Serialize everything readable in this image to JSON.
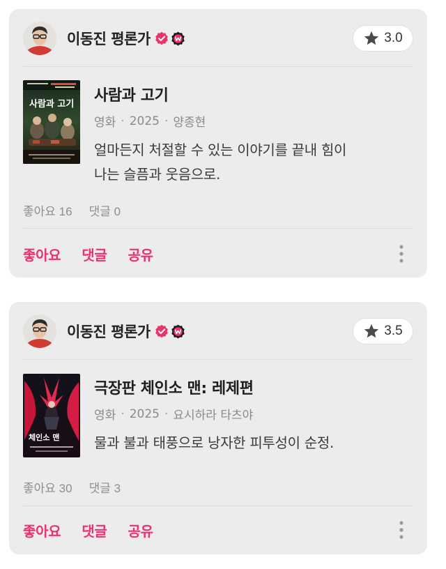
{
  "reviews": [
    {
      "author": "이동진 평론가",
      "rating": "3.0",
      "title": "사람과 고기",
      "category": "영화",
      "year": "2025",
      "director": "양종현",
      "text_lines": [
        "얼마든지 처절할 수 있는 이야기를 끝내 힘이",
        "나는 슬픔과 웃음으로."
      ],
      "likes": "좋아요 16",
      "comments": "댓글 0",
      "poster_title": "사람과 고기"
    },
    {
      "author": "이동진 평론가",
      "rating": "3.5",
      "title": "극장판 체인소 맨: 레제편",
      "category": "영화",
      "year": "2025",
      "director": "요시하라 타츠야",
      "text_lines": [
        "물과 불과 태풍으로 낭자한 피투성이 순정."
      ],
      "likes": "좋아요 30",
      "comments": "댓글 3",
      "poster_title": "체인소 맨"
    }
  ],
  "actions": {
    "like": "좋아요",
    "comment": "댓글",
    "share": "공유"
  },
  "colors": {
    "accent": "#e8336d",
    "card_bg": "#ececed",
    "verified": "#e8336d",
    "badge_w": "#d62a5e"
  },
  "icons": {
    "verified": "verified-check-icon",
    "watcha": "watcha-w-badge-icon",
    "star": "star-icon",
    "more": "more-vertical-icon"
  }
}
